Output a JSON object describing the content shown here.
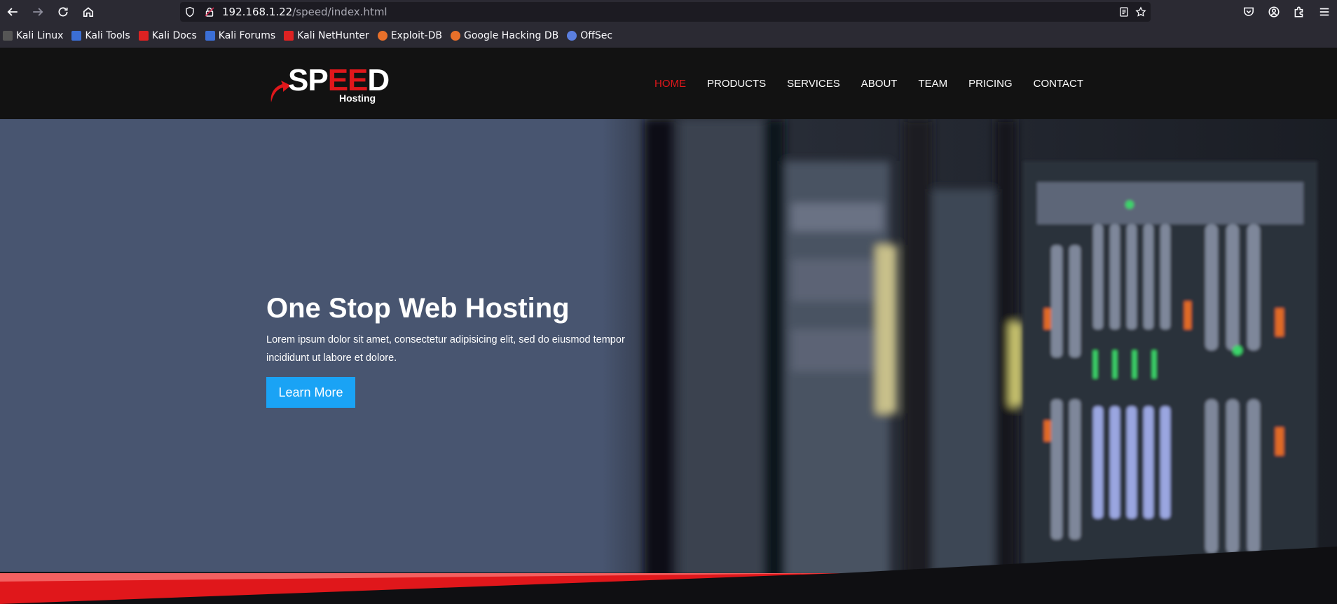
{
  "browser": {
    "url_host": "192.168.1.22",
    "url_path": "/speed/index.html",
    "bookmarks": [
      {
        "label": "Kali Linux",
        "color": "#3d3d3d"
      },
      {
        "label": "Kali Tools",
        "color": "#3b6fd6"
      },
      {
        "label": "Kali Docs",
        "color": "#d22"
      },
      {
        "label": "Kali Forums",
        "color": "#3b6fd6"
      },
      {
        "label": "Kali NetHunter",
        "color": "#d22"
      },
      {
        "label": "Exploit-DB",
        "color": "#e8702a"
      },
      {
        "label": "Google Hacking DB",
        "color": "#e8702a"
      },
      {
        "label": "OffSec",
        "color": "#5b7fe0"
      }
    ]
  },
  "site": {
    "logo": {
      "word_white": "SP",
      "word_red": "EE",
      "word_end": "D",
      "sub": "Hosting"
    },
    "menu": [
      {
        "label": "HOME",
        "active": true
      },
      {
        "label": "PRODUCTS",
        "active": false
      },
      {
        "label": "SERVICES",
        "active": false
      },
      {
        "label": "ABOUT",
        "active": false
      },
      {
        "label": "TEAM",
        "active": false
      },
      {
        "label": "PRICING",
        "active": false
      },
      {
        "label": "CONTACT",
        "active": false
      }
    ],
    "hero": {
      "title": "One Stop Web Hosting",
      "text": "Lorem ipsum dolor sit amet, consectetur adipisicing elit, sed do eiusmod tempor incididunt ut labore et dolore.",
      "button": "Learn More"
    },
    "colors": {
      "accent_red": "#e0171b",
      "button_blue": "#1aa3f5",
      "header_bg": "#121212",
      "hero_bg": "#485570"
    }
  }
}
